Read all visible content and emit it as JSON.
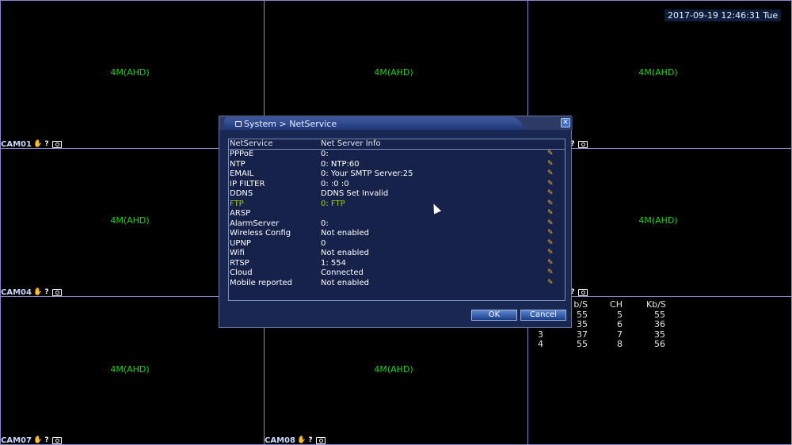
{
  "clock": "2017-09-19 12:46:31 Tue",
  "resolution_label": "4M(AHD)",
  "cameras": [
    "CAM01",
    "CAM04",
    "CAM07",
    "CAM08"
  ],
  "icons": {
    "manual": "hand-icon",
    "help": "help-icon",
    "snapshot": "camera-icon"
  },
  "stats": {
    "headers": [
      "b/S",
      "CH",
      "Kb/S"
    ],
    "rows": [
      [
        "",
        "55",
        "5",
        "55"
      ],
      [
        "",
        "35",
        "6",
        "36"
      ],
      [
        "3",
        "37",
        "7",
        "35"
      ],
      [
        "4",
        "55",
        "8",
        "56"
      ]
    ]
  },
  "dialog": {
    "title": "System > NetService",
    "columns": [
      "NetService",
      "Net Server Info"
    ],
    "rows": [
      {
        "service": "PPPoE",
        "info": "0:"
      },
      {
        "service": "NTP",
        "info": "0: NTP:60"
      },
      {
        "service": "EMAIL",
        "info": "0: Your SMTP Server:25"
      },
      {
        "service": "IP FILTER",
        "info": "0: :0 :0"
      },
      {
        "service": "DDNS",
        "info": "DDNS Set Invalid"
      },
      {
        "service": "FTP",
        "info": "0: FTP"
      },
      {
        "service": "ARSP",
        "info": ""
      },
      {
        "service": "AlarmServer",
        "info": "0:"
      },
      {
        "service": "Wireless Config",
        "info": "Not enabled"
      },
      {
        "service": "UPNP",
        "info": "0"
      },
      {
        "service": "Wifi",
        "info": "Not enabled"
      },
      {
        "service": "RTSP",
        "info": "1: 554"
      },
      {
        "service": "Cloud",
        "info": "Connected"
      },
      {
        "service": "Mobile reported",
        "info": "Not enabled"
      }
    ],
    "selected_row": "FTP",
    "ok_label": "OK",
    "cancel_label": "Cancel"
  },
  "colors": {
    "grid": "#8a86c8",
    "resolution": "#1ed21e",
    "selected": "#9cd21e",
    "dialog_bg": "#182852"
  }
}
